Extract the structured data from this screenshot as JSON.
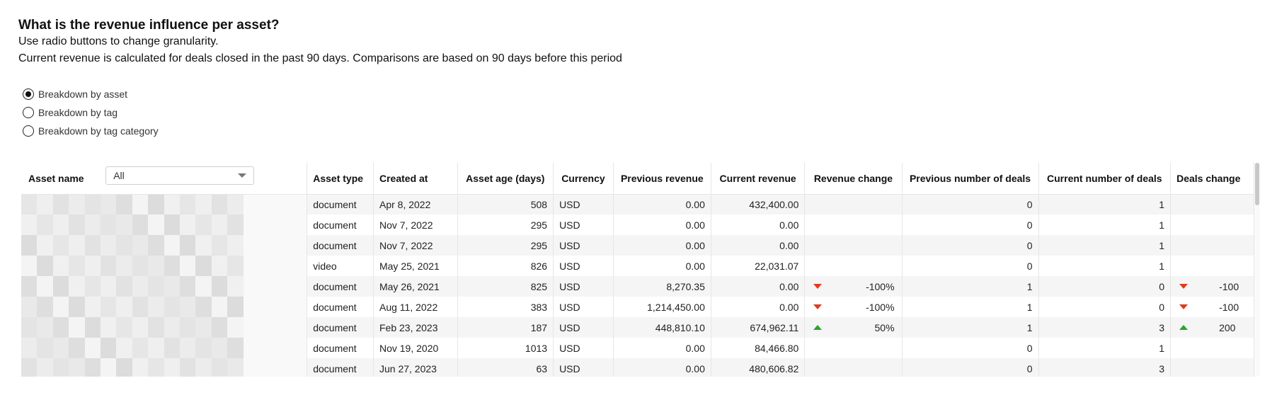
{
  "header": {
    "title": "What is the revenue influence per asset?",
    "subtitle_1": "Use radio buttons to change granularity.",
    "subtitle_2": "Current revenue is calculated for deals closed in the past 90 days. Comparisons are based on 90 days before this period"
  },
  "granularity": {
    "options": [
      {
        "label": "Breakdown by asset",
        "checked": true
      },
      {
        "label": "Breakdown by tag",
        "checked": false
      },
      {
        "label": "Breakdown by tag category",
        "checked": false
      }
    ]
  },
  "table": {
    "filter": {
      "value": "All"
    },
    "columns": {
      "asset_name": "Asset name",
      "asset_type": "Asset type",
      "created_at": "Created at",
      "asset_age": "Asset age (days)",
      "currency": "Currency",
      "previous_revenue": "Previous revenue",
      "current_revenue": "Current revenue",
      "revenue_change": "Revenue change",
      "previous_deals": "Previous number of deals",
      "current_deals": "Current number of deals",
      "deals_change": "Deals change"
    },
    "rows": [
      {
        "type": "document",
        "created": "Apr 8, 2022",
        "age": "508",
        "currency": "USD",
        "prev_rev": "0.00",
        "cur_rev": "432,400.00",
        "rev_change": "",
        "rev_dir": "",
        "prev_deals": "0",
        "cur_deals": "1",
        "deals_change": "",
        "deals_dir": ""
      },
      {
        "type": "document",
        "created": "Nov 7, 2022",
        "age": "295",
        "currency": "USD",
        "prev_rev": "0.00",
        "cur_rev": "0.00",
        "rev_change": "",
        "rev_dir": "",
        "prev_deals": "0",
        "cur_deals": "1",
        "deals_change": "",
        "deals_dir": ""
      },
      {
        "type": "document",
        "created": "Nov 7, 2022",
        "age": "295",
        "currency": "USD",
        "prev_rev": "0.00",
        "cur_rev": "0.00",
        "rev_change": "",
        "rev_dir": "",
        "prev_deals": "0",
        "cur_deals": "1",
        "deals_change": "",
        "deals_dir": ""
      },
      {
        "type": "video",
        "created": "May 25, 2021",
        "age": "826",
        "currency": "USD",
        "prev_rev": "0.00",
        "cur_rev": "22,031.07",
        "rev_change": "",
        "rev_dir": "",
        "prev_deals": "0",
        "cur_deals": "1",
        "deals_change": "",
        "deals_dir": ""
      },
      {
        "type": "document",
        "created": "May 26, 2021",
        "age": "825",
        "currency": "USD",
        "prev_rev": "8,270.35",
        "cur_rev": "0.00",
        "rev_change": "-100%",
        "rev_dir": "down",
        "prev_deals": "1",
        "cur_deals": "0",
        "deals_change": "-100",
        "deals_dir": "down"
      },
      {
        "type": "document",
        "created": "Aug 11, 2022",
        "age": "383",
        "currency": "USD",
        "prev_rev": "1,214,450.00",
        "cur_rev": "0.00",
        "rev_change": "-100%",
        "rev_dir": "down",
        "prev_deals": "1",
        "cur_deals": "0",
        "deals_change": "-100",
        "deals_dir": "down"
      },
      {
        "type": "document",
        "created": "Feb 23, 2023",
        "age": "187",
        "currency": "USD",
        "prev_rev": "448,810.10",
        "cur_rev": "674,962.11",
        "rev_change": "50%",
        "rev_dir": "up",
        "prev_deals": "1",
        "cur_deals": "3",
        "deals_change": "200",
        "deals_dir": "up"
      },
      {
        "type": "document",
        "created": "Nov 19, 2020",
        "age": "1013",
        "currency": "USD",
        "prev_rev": "0.00",
        "cur_rev": "84,466.80",
        "rev_change": "",
        "rev_dir": "",
        "prev_deals": "0",
        "cur_deals": "1",
        "deals_change": "",
        "deals_dir": ""
      },
      {
        "type": "document",
        "created": "Jun 27, 2023",
        "age": "63",
        "currency": "USD",
        "prev_rev": "0.00",
        "cur_rev": "480,606.82",
        "rev_change": "",
        "rev_dir": "",
        "prev_deals": "0",
        "cur_deals": "3",
        "deals_change": "",
        "deals_dir": ""
      }
    ]
  },
  "colors": {
    "down": "#e03a1e",
    "up": "#2aa52a"
  }
}
